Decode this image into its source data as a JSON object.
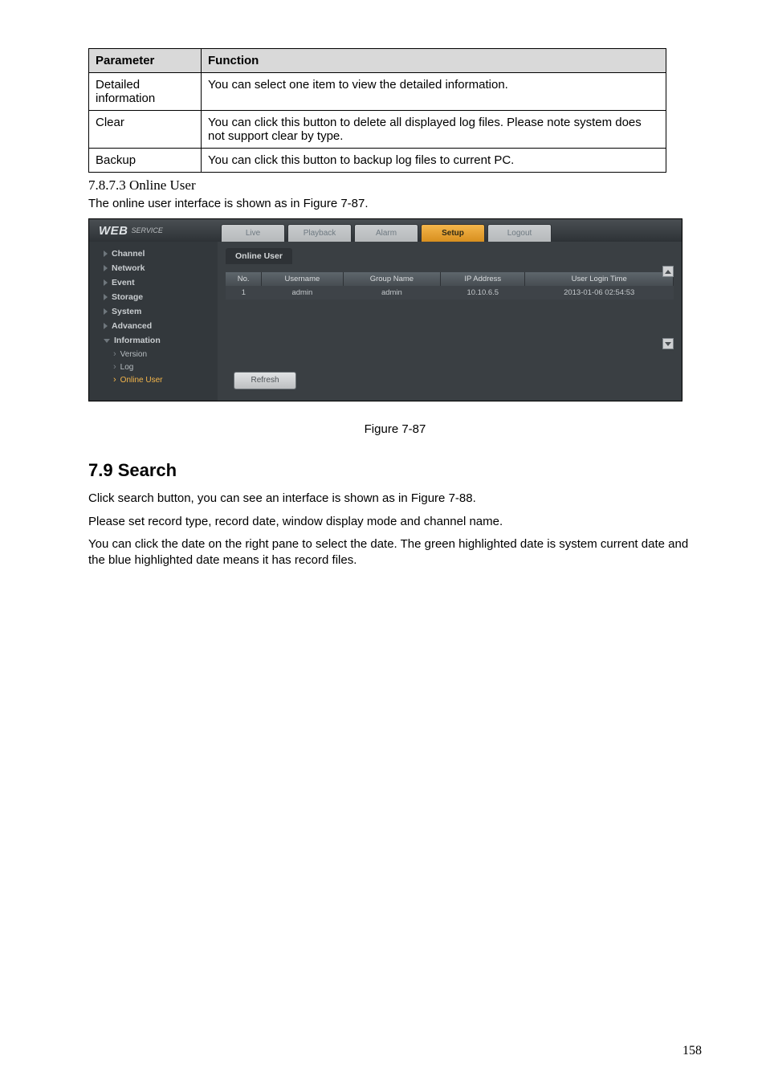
{
  "paramTable": {
    "headers": {
      "parameter": "Parameter",
      "function": "Function"
    },
    "rows": [
      {
        "param": "Detailed information",
        "func": "You can select one item to view the detailed information."
      },
      {
        "param": "Clear",
        "func": "You can click this button to delete all displayed log files.  Please note system does not support clear by type."
      },
      {
        "param": "Backup",
        "func": "You can click this button to backup log files to current PC."
      }
    ]
  },
  "subHeading": "7.8.7.3 Online User",
  "introLine": "The online user interface is shown as in Figure 7-87.",
  "ui": {
    "logo": {
      "web": "WEB",
      "service": "SERVICE"
    },
    "tabs": {
      "live": "Live",
      "playback": "Playback",
      "alarm": "Alarm",
      "setup": "Setup",
      "logout": "Logout"
    },
    "side": {
      "channel": "Channel",
      "network": "Network",
      "event": "Event",
      "storage": "Storage",
      "system": "System",
      "advanced": "Advanced",
      "information": "Information",
      "version": "Version",
      "log": "Log",
      "onlineUser": "Online User"
    },
    "main": {
      "tabLabel": "Online User",
      "cols": {
        "no": "No.",
        "username": "Username",
        "group": "Group Name",
        "ip": "IP Address",
        "login": "User Login Time"
      },
      "row": {
        "no": "1",
        "username": "admin",
        "group": "admin",
        "ip": "10.10.6.5",
        "login": "2013-01-06 02:54:53"
      },
      "refresh": "Refresh"
    }
  },
  "figureCaption": "Figure 7-87",
  "sectionHeading": "7.9   Search",
  "para1": "Click search button, you can see an interface is shown as in Figure 7-88.",
  "para2": "Please set record type, record date, window display mode and channel name.",
  "para3": "You can click the date on the right pane to select the date. The green highlighted date is system current date and the blue highlighted date means it has record files.",
  "pageNumber": "158"
}
